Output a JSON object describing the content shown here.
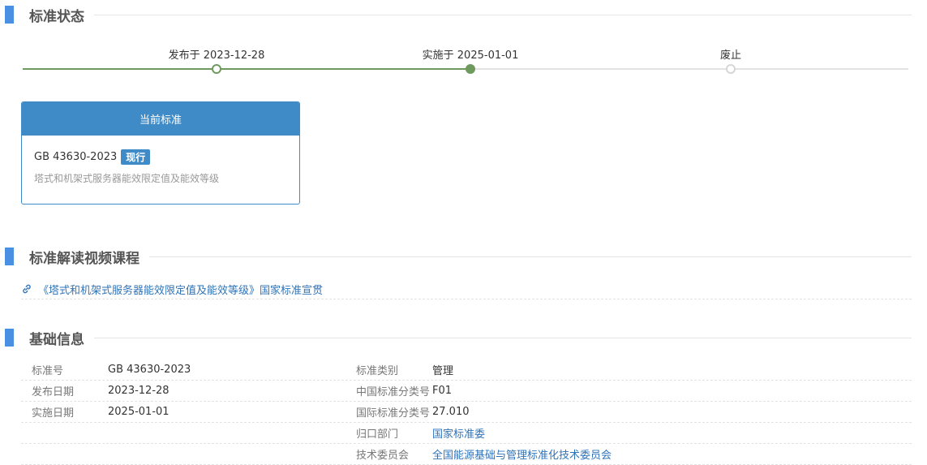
{
  "status_section": {
    "title": "标准状态",
    "timeline": [
      {
        "label": "发布于 2023-12-28",
        "state": "done"
      },
      {
        "label": "实施于 2025-01-01",
        "state": "current"
      },
      {
        "label": "废止",
        "state": "future"
      }
    ],
    "current_card": {
      "header": "当前标准",
      "code": "GB 43630-2023",
      "badge": "现行",
      "name": "塔式和机架式服务器能效限定值及能效等级"
    }
  },
  "video_section": {
    "title": "标准解读视频课程",
    "link_icon": "link-icon",
    "link_text": "《塔式和机架式服务器能效限定值及能效等级》国家标准宣贯"
  },
  "info_section": {
    "title": "基础信息",
    "rows": [
      {
        "label1": "标准号",
        "value1": "GB 43630-2023",
        "label2": "标准类别",
        "value2": "管理"
      },
      {
        "label1": "发布日期",
        "value1": "2023-12-28",
        "label2": "中国标准分类号",
        "value2": "F01"
      },
      {
        "label1": "实施日期",
        "value1": "2025-01-01",
        "label2": "国际标准分类号",
        "value2": "27.010"
      },
      {
        "label1": "",
        "value1": "",
        "label2": "归口部门",
        "value2": "国家标准委"
      },
      {
        "label1": "",
        "value1": "",
        "label2": "技术委员会",
        "value2": "全国能源基础与管理标准化技术委员会"
      }
    ]
  },
  "colors": {
    "accent": "#3f8bc8",
    "progress": "#6e9a5e",
    "link": "#2f73b8"
  }
}
